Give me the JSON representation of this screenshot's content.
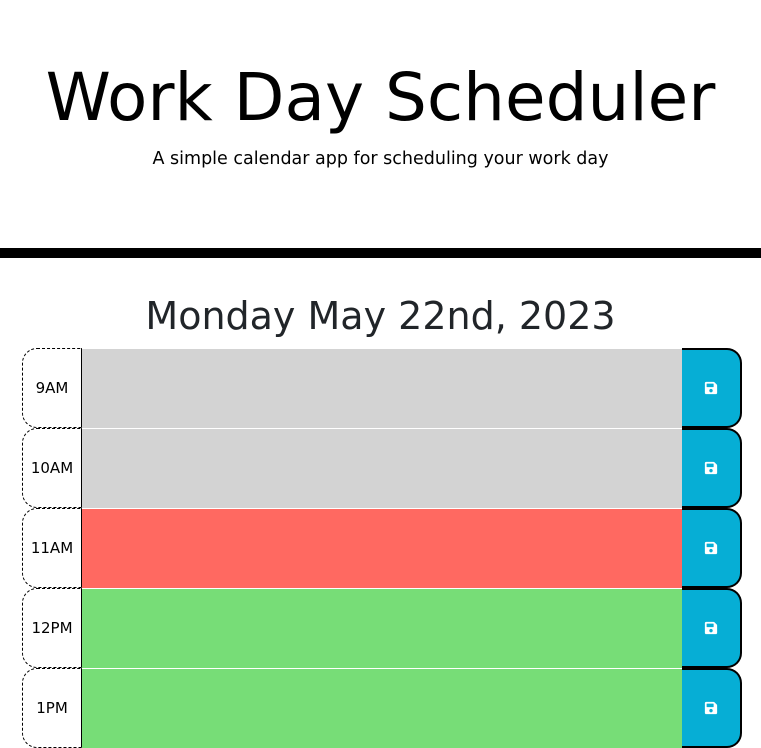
{
  "header": {
    "title": "Work Day Scheduler",
    "subtitle": "A simple calendar app for scheduling your work day"
  },
  "current_day": "Monday May 22nd, 2023",
  "colors": {
    "past": "#d3d3d3",
    "present": "#ff6961",
    "future": "#77dd77",
    "save_button": "#06aed5"
  },
  "time_blocks": [
    {
      "hour": "9AM",
      "status": "past",
      "text": "",
      "save_icon": "floppy-disk-icon"
    },
    {
      "hour": "10AM",
      "status": "past",
      "text": "",
      "save_icon": "floppy-disk-icon"
    },
    {
      "hour": "11AM",
      "status": "present",
      "text": "",
      "save_icon": "floppy-disk-icon"
    },
    {
      "hour": "12PM",
      "status": "future",
      "text": "",
      "save_icon": "floppy-disk-icon"
    },
    {
      "hour": "1PM",
      "status": "future",
      "text": "",
      "save_icon": "floppy-disk-icon"
    }
  ]
}
